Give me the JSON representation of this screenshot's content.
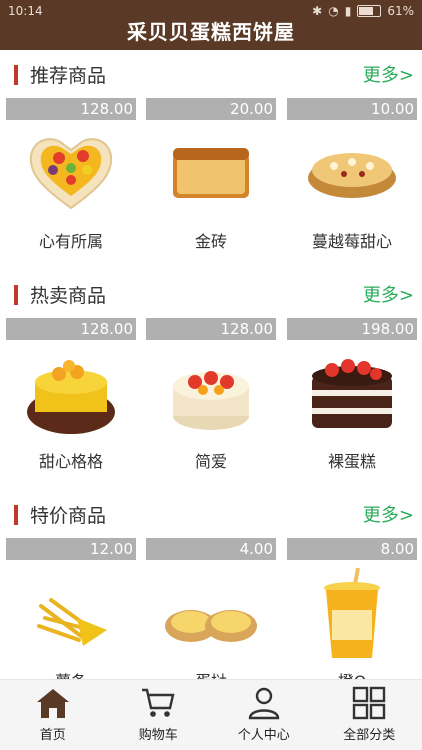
{
  "status_bar": {
    "time": "10:14",
    "battery": "61%",
    "battery_level": 0.61
  },
  "header": {
    "title": "采贝贝蛋糕西饼屋"
  },
  "sections": [
    {
      "title": "推荐商品",
      "more": "更多>",
      "items": [
        {
          "price": "128.00",
          "name": "心有所属",
          "icon": "heart-fruit-cake-image"
        },
        {
          "price": "20.00",
          "name": "金砖",
          "icon": "brick-cake-image"
        },
        {
          "price": "10.00",
          "name": "蔓越莓甜心",
          "icon": "cranberry-pastry-image"
        }
      ]
    },
    {
      "title": "热卖商品",
      "more": "更多>",
      "items": [
        {
          "price": "128.00",
          "name": "甜心格格",
          "icon": "mango-cake-image"
        },
        {
          "price": "128.00",
          "name": "简爱",
          "icon": "strawberry-cream-cake-image"
        },
        {
          "price": "198.00",
          "name": "裸蛋糕",
          "icon": "naked-cake-image"
        }
      ]
    },
    {
      "title": "特价商品",
      "more": "更多>",
      "items": [
        {
          "price": "12.00",
          "name": "薯条",
          "icon": "fries-image"
        },
        {
          "price": "4.00",
          "name": "蛋挞",
          "icon": "egg-tart-image"
        },
        {
          "price": "8.00",
          "name": "橙Q",
          "icon": "orange-drink-image"
        }
      ]
    }
  ],
  "tabbar": [
    {
      "label": "首页",
      "icon": "home-icon"
    },
    {
      "label": "购物车",
      "icon": "cart-icon"
    },
    {
      "label": "个人中心",
      "icon": "user-icon"
    },
    {
      "label": "全部分类",
      "icon": "grid-icon"
    }
  ],
  "colors": {
    "header_bg": "#5a3a26",
    "accent_bar": "#c0392b",
    "more_link": "#2bab5c",
    "price_bg": "#b0b0b0"
  }
}
